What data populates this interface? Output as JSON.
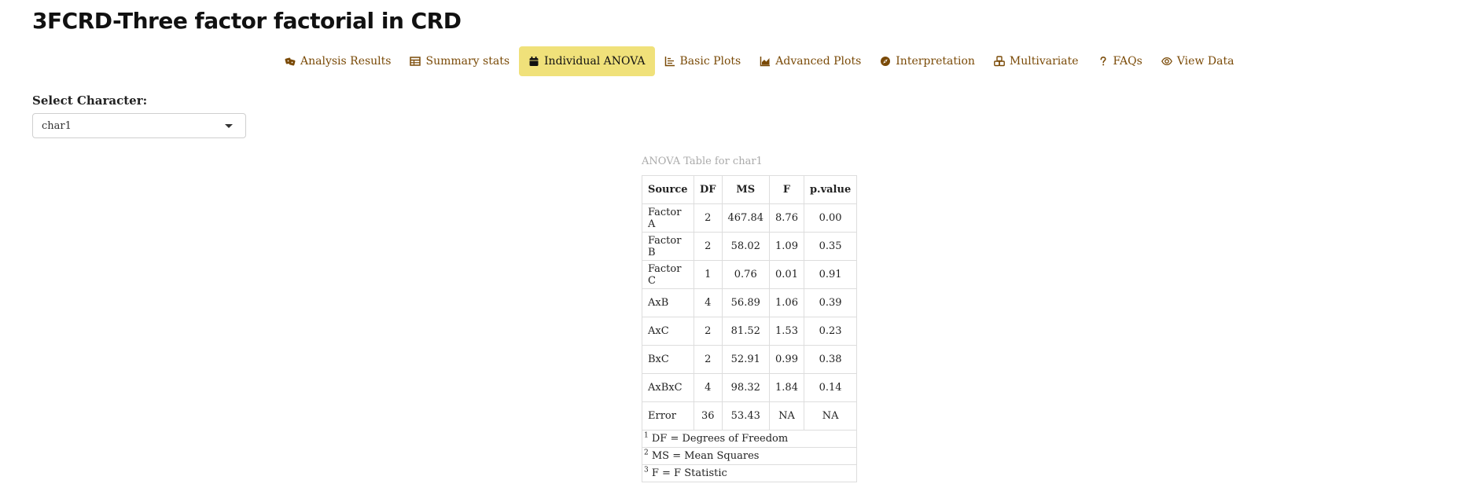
{
  "app": {
    "title": "3FCRD-Three factor factorial in CRD"
  },
  "tabs": [
    {
      "label": "Analysis Results",
      "icon": "dice-icon",
      "active": false
    },
    {
      "label": "Summary stats",
      "icon": "table-icon",
      "active": false
    },
    {
      "label": "Individual ANOVA",
      "icon": "calendar-icon",
      "active": true
    },
    {
      "label": "Basic Plots",
      "icon": "line-chart-icon",
      "active": false
    },
    {
      "label": "Advanced Plots",
      "icon": "area-chart-icon",
      "active": false
    },
    {
      "label": "Interpretation",
      "icon": "compass-icon",
      "active": false
    },
    {
      "label": "Multivariate",
      "icon": "cubes-icon",
      "active": false
    },
    {
      "label": "FAQs",
      "icon": "question-icon",
      "active": false
    },
    {
      "label": "View Data",
      "icon": "eye-icon",
      "active": false
    }
  ],
  "selector": {
    "label": "Select Character:",
    "value": "char1"
  },
  "anova": {
    "caption": "ANOVA Table for char1",
    "headers": [
      "Source",
      "DF",
      "MS",
      "F",
      "p.value"
    ],
    "rows": [
      [
        "Factor A",
        "2",
        "467.84",
        "8.76",
        "0.00"
      ],
      [
        "Factor B",
        "2",
        "58.02",
        "1.09",
        "0.35"
      ],
      [
        "Factor C",
        "1",
        "0.76",
        "0.01",
        "0.91"
      ],
      [
        "AxB",
        "4",
        "56.89",
        "1.06",
        "0.39"
      ],
      [
        "AxC",
        "2",
        "81.52",
        "1.53",
        "0.23"
      ],
      [
        "BxC",
        "2",
        "52.91",
        "0.99",
        "0.38"
      ],
      [
        "AxBxC",
        "4",
        "98.32",
        "1.84",
        "0.14"
      ],
      [
        "Error",
        "36",
        "53.43",
        "NA",
        "NA"
      ]
    ],
    "footnotes": [
      {
        "mark": "1",
        "text": "DF = Degrees of Freedom"
      },
      {
        "mark": "2",
        "text": "MS = Mean Squares"
      },
      {
        "mark": "3",
        "text": "F = F Statistic"
      }
    ]
  },
  "colors": {
    "tab_text": "#7a4a07",
    "active_tab_bg": "#f0e17a"
  }
}
